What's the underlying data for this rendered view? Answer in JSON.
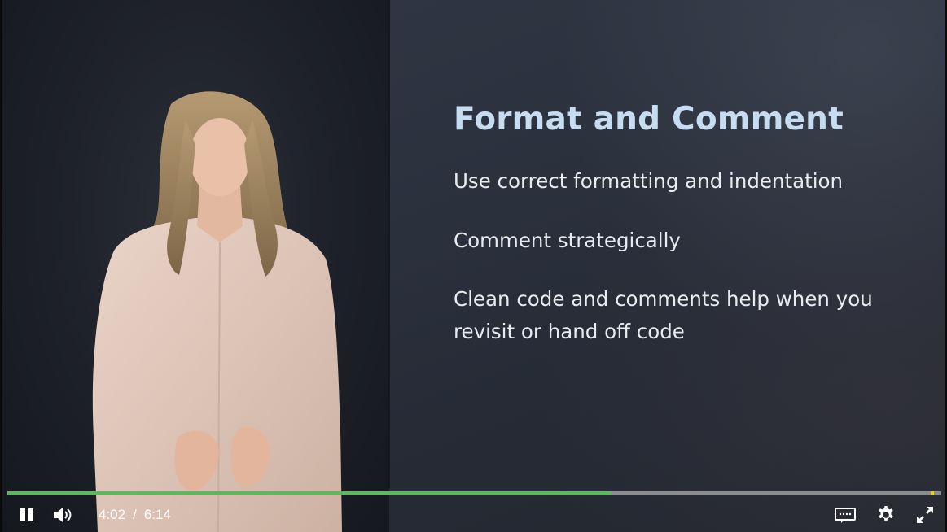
{
  "slide": {
    "title": "Format and Comment",
    "bullets": [
      "Use correct formatting and indentation",
      "Comment strategically",
      "Clean code and comments help when you revisit or hand off code"
    ]
  },
  "player": {
    "current_time": "4:02",
    "separator": "/",
    "duration": "6:14",
    "progress_fraction": 0.647,
    "buffered_marker_fraction": 0.989,
    "state": "playing",
    "icons": {
      "play_pause": "pause-icon",
      "volume": "volume-icon",
      "captions": "captions-icon",
      "settings": "gear-icon",
      "fullscreen": "fullscreen-icon"
    },
    "colors": {
      "progress": "#5cb85c",
      "marker": "#f0d000",
      "track": "#8a8c90",
      "title": "#c6dcf0"
    }
  }
}
